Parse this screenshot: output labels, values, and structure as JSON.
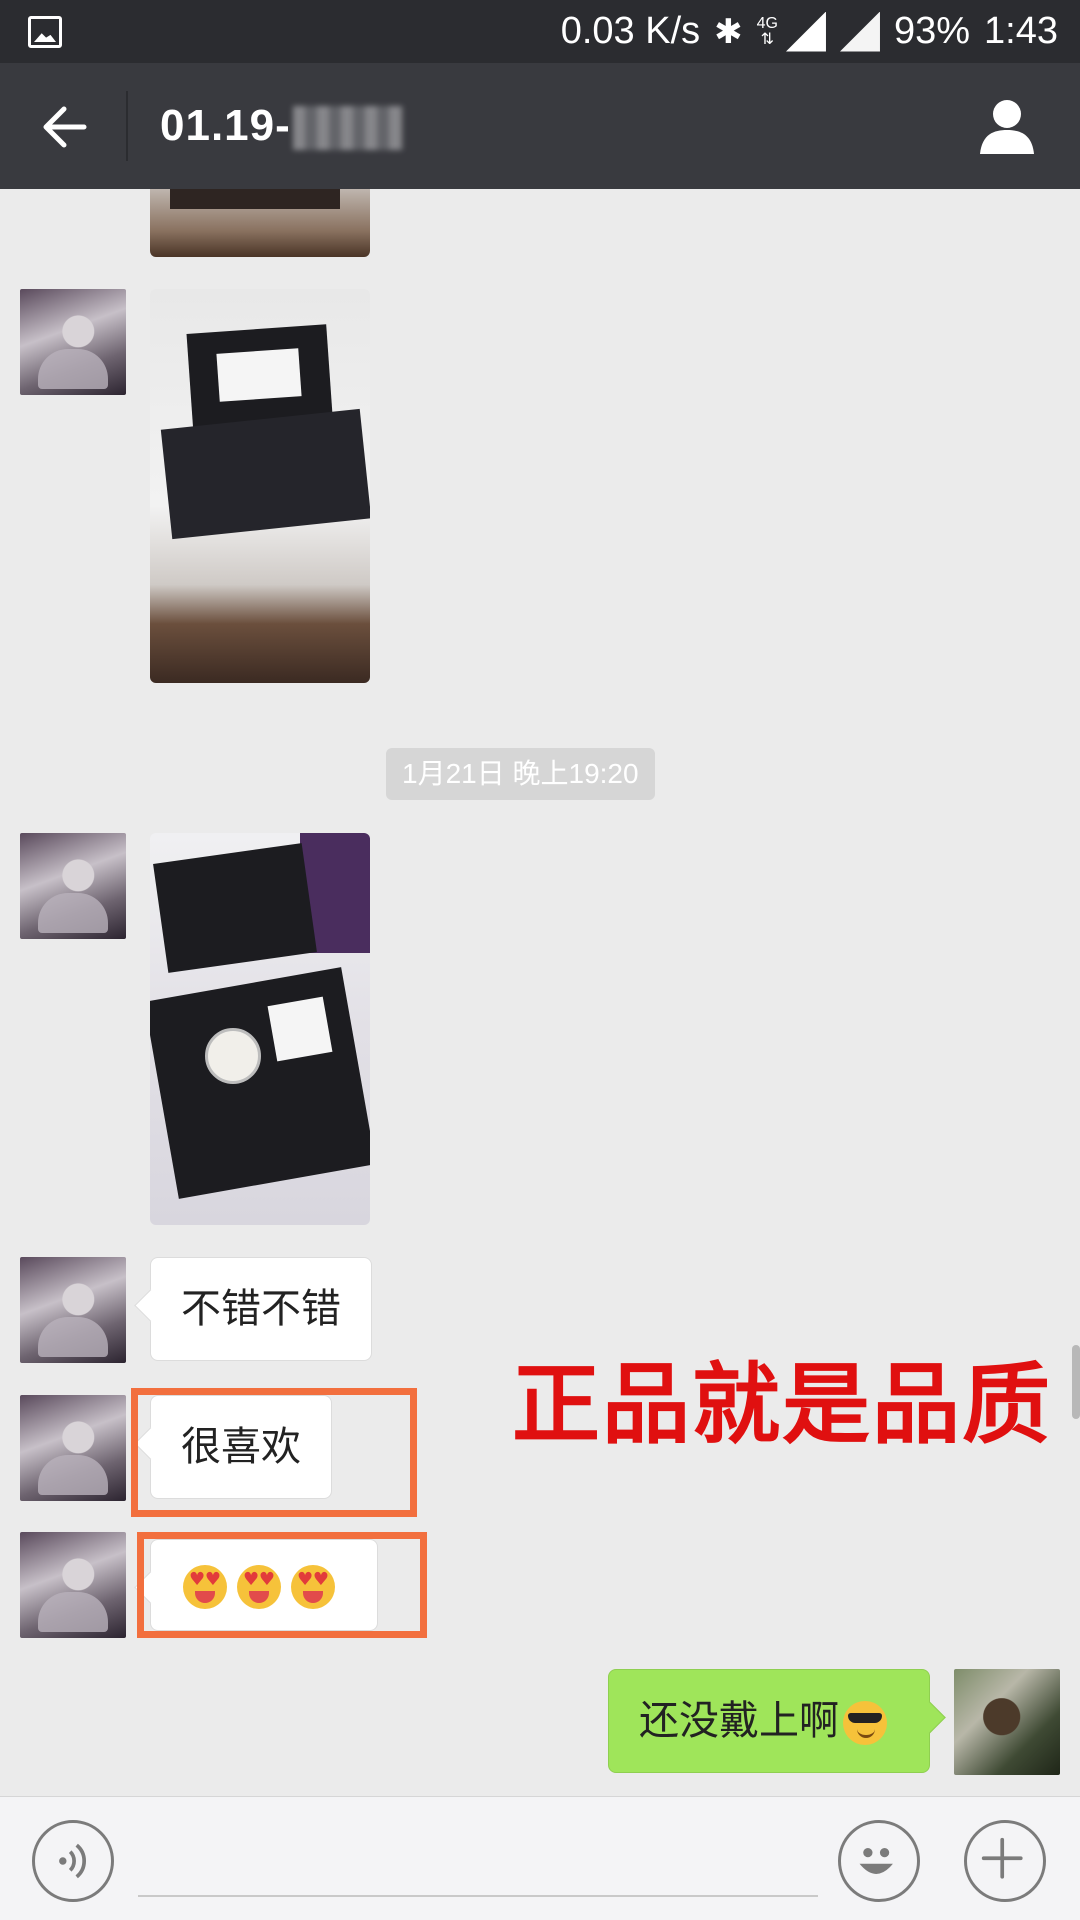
{
  "status_bar": {
    "speed": "0.03 K/s",
    "network": "4G",
    "battery": "93%",
    "time": "1:43"
  },
  "header": {
    "title": "01.19-"
  },
  "chat": {
    "timestamp": "1月21日 晚上19:20",
    "messages": [
      {
        "text": "不错不错"
      },
      {
        "text": "很喜欢"
      },
      {
        "text": ""
      },
      {
        "text": "还没戴上啊"
      }
    ],
    "overlay_caption": "正品就是品质"
  },
  "colors": {
    "header_bg": "#393a3f",
    "chat_bg": "#ebebeb",
    "my_bubble": "#9fe55a",
    "highlight": "#f26f3e",
    "caption": "#e01010"
  }
}
